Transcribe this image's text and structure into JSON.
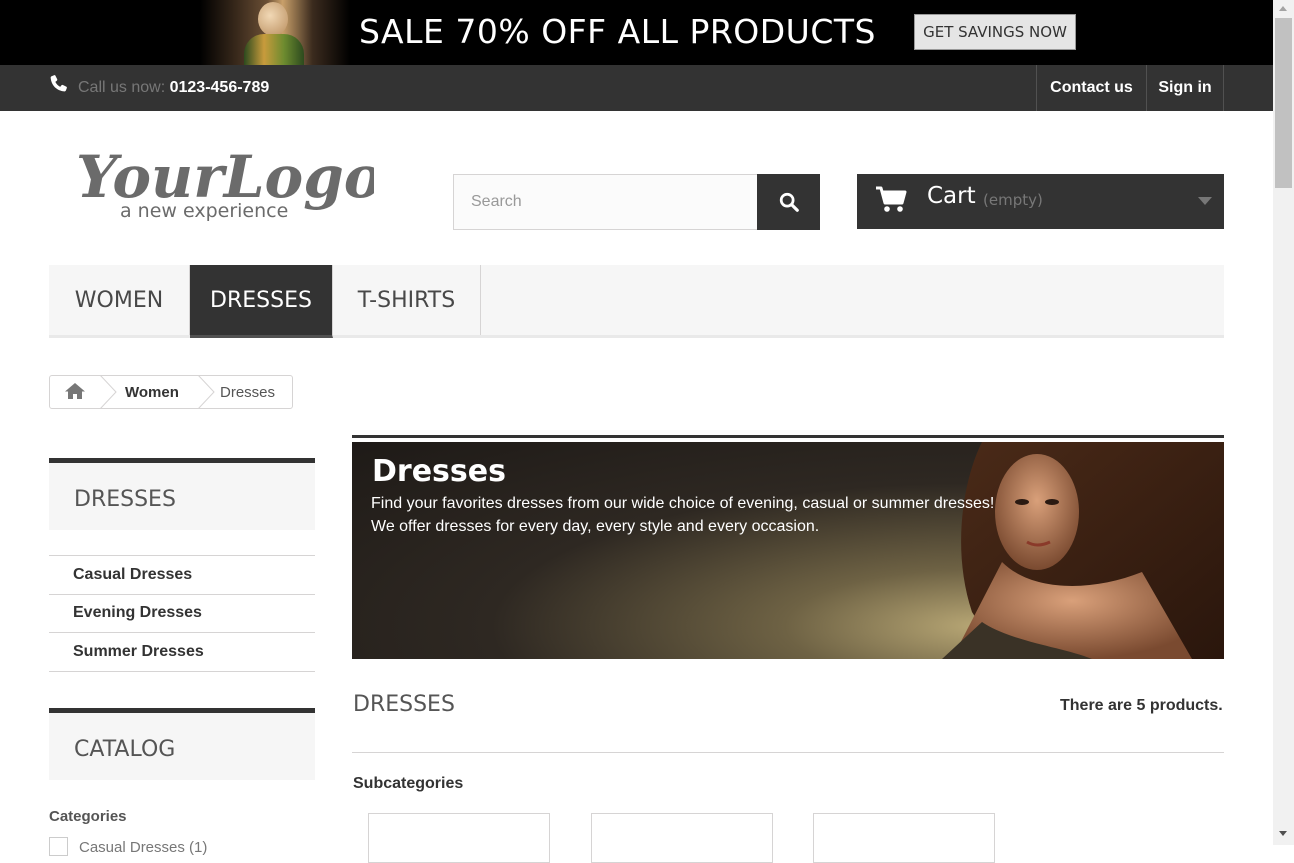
{
  "promo": {
    "text": "SALE 70% OFF ALL PRODUCTS",
    "button": "GET SAVINGS NOW"
  },
  "topnav": {
    "call_label": "Call us now:",
    "phone": "0123-456-789",
    "contact": "Contact us",
    "signin": "Sign in"
  },
  "header": {
    "logo": {
      "main": "YourLogo",
      "tagline": "a new experience"
    },
    "search": {
      "placeholder": "Search"
    },
    "cart": {
      "label": "Cart",
      "status": "(empty)"
    }
  },
  "menu": {
    "items": [
      "WOMEN",
      "DRESSES",
      "T-SHIRTS"
    ],
    "active": "DRESSES"
  },
  "breadcrumb": {
    "items": [
      "Women",
      "Dresses"
    ]
  },
  "sidebar": {
    "dresses_title": "DRESSES",
    "subcategories": [
      "Casual Dresses",
      "Evening Dresses",
      "Summer Dresses"
    ],
    "catalog_title": "CATALOG",
    "filter_label": "Categories",
    "filter_first": "Casual Dresses (1)"
  },
  "category": {
    "title": "Dresses",
    "description_lines": [
      "Find your favorites dresses from our wide choice of evening, casual or summer dresses!",
      "We offer dresses for every day, every style and every occasion."
    ],
    "heading": "DRESSES",
    "count": "There are 5 products.",
    "subcategories_label": "Subcategories"
  },
  "colors": {
    "dark": "#333333",
    "light_bg": "#f6f6f6",
    "border": "#d6d4d4"
  }
}
